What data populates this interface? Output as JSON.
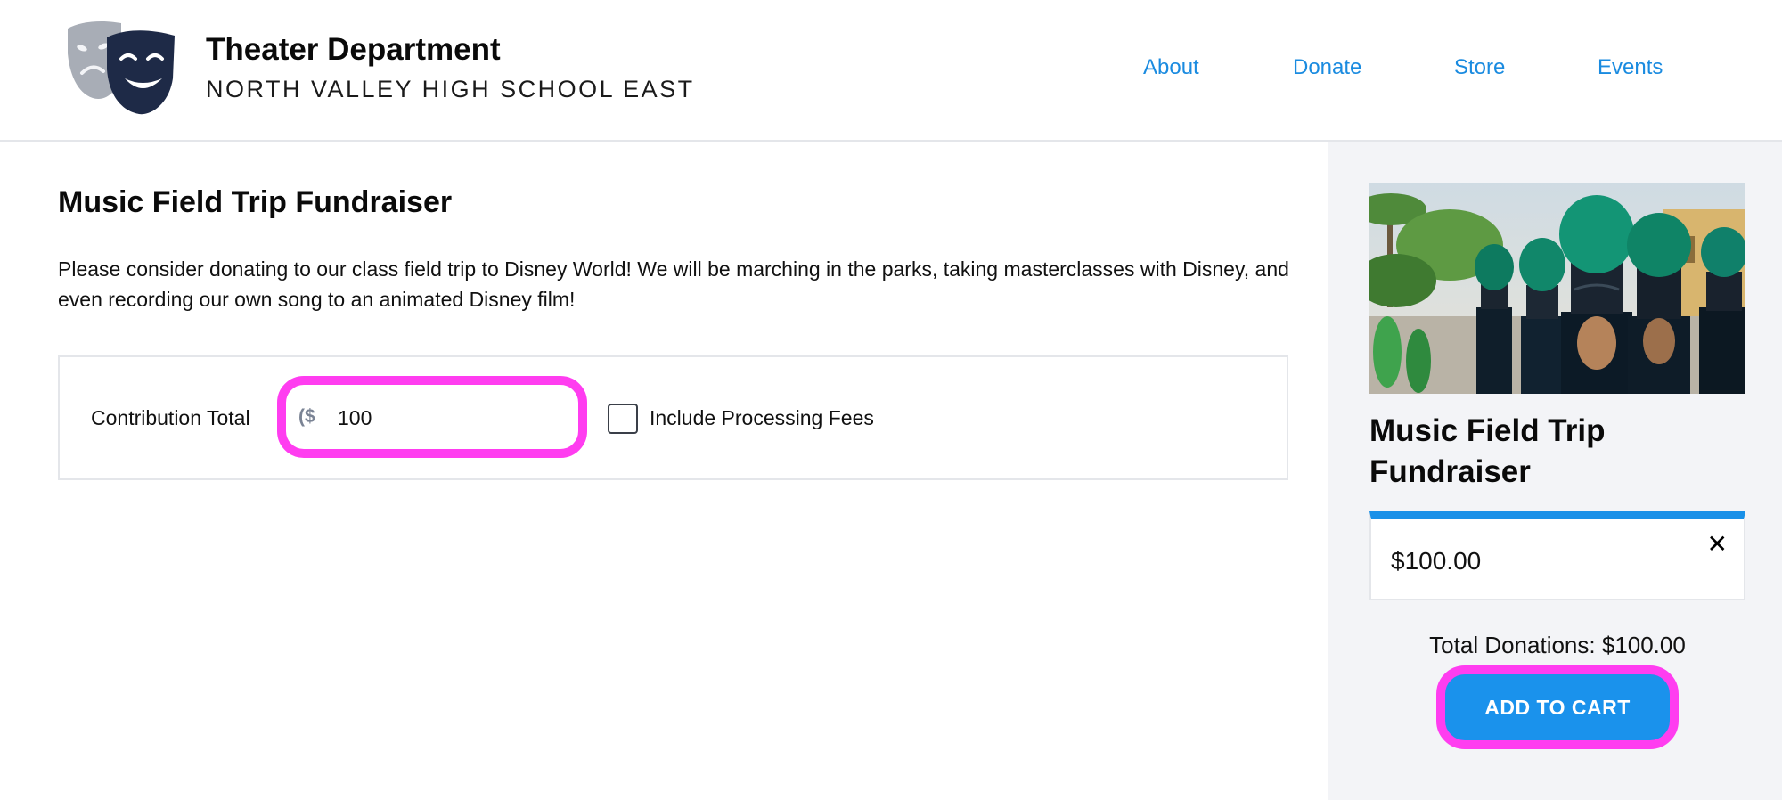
{
  "header": {
    "title": "Theater Department",
    "subtitle": "NORTH VALLEY HIGH SCHOOL EAST",
    "logo_icon": "theater-masks-icon",
    "nav": [
      {
        "label": "About"
      },
      {
        "label": "Donate"
      },
      {
        "label": "Store"
      },
      {
        "label": "Events"
      }
    ]
  },
  "main": {
    "title": "Music Field Trip Fundraiser",
    "description": "Please consider donating to our class field trip to Disney World! We will be marching in the parks, taking masterclasses with Disney, and even recording our own song to an animated Disney film!",
    "form": {
      "contribution_label": "Contribution Total",
      "currency_prefix": "($",
      "amount_value": "100",
      "include_fees_label": "Include Processing Fees",
      "include_fees_checked": false
    }
  },
  "sidebar": {
    "image_icon": "marching-band-photo",
    "title": "Music Field Trip Fundraiser",
    "cart_item_amount": "$100.00",
    "close_icon": "close-icon",
    "total_text": "Total Donations: $100.00",
    "add_to_cart_label": "ADD TO CART"
  },
  "colors": {
    "accent": "#1a92ec",
    "link": "#1a8be0",
    "highlight": "#ff3df0",
    "sidebar_bg": "#f3f4f7"
  }
}
